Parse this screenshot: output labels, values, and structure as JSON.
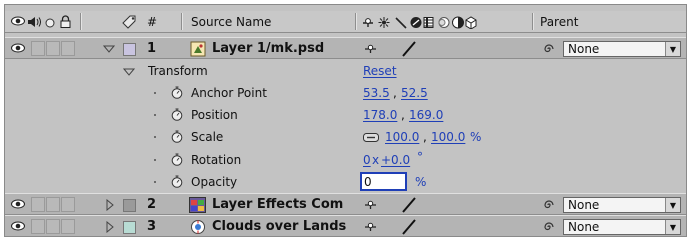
{
  "header": {
    "number_col": "#",
    "source_name_col": "Source Name",
    "parent_col": "Parent"
  },
  "layers": [
    {
      "number": "1",
      "name": "Layer 1/mk.psd",
      "parent": "None",
      "label_color": "#c9c4e0",
      "icon": "psd-layer-icon",
      "expanded": true
    },
    {
      "number": "2",
      "name": "Layer Effects Com",
      "parent": "None",
      "label_color": "#9a9a9a",
      "icon": "composition-thumbnail-icon",
      "expanded": false
    },
    {
      "number": "3",
      "name": "Clouds over Lands",
      "parent": "None",
      "label_color": "#b8dcd4",
      "icon": "composition-icon",
      "expanded": false
    }
  ],
  "transform": {
    "label": "Transform",
    "reset": "Reset",
    "anchor_point": {
      "label": "Anchor Point",
      "x": "53.5",
      "y": "52.5"
    },
    "position": {
      "label": "Position",
      "x": "178.0",
      "y": "169.0"
    },
    "scale": {
      "label": "Scale",
      "x": "100.0",
      "y": "100.0",
      "unit": "%"
    },
    "rotation": {
      "label": "Rotation",
      "revolutions": "0",
      "degrees": "+0.0"
    },
    "opacity": {
      "label": "Opacity",
      "value": "0",
      "unit": "%"
    }
  },
  "colors": {
    "panel_bg": "#c3c3c3",
    "value_blue": "#1f3fb7",
    "layer_row_bg": "#b4b4b4"
  }
}
